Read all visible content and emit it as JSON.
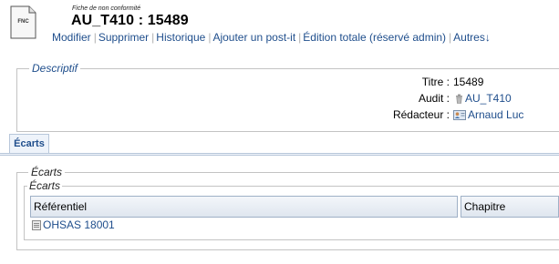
{
  "header": {
    "icon_label": "FNC",
    "subtitle": "Fiche de non conformité",
    "title": "AU_T410 : 15489"
  },
  "actions": [
    {
      "label": "Modifier"
    },
    {
      "label": "Supprimer"
    },
    {
      "label": "Historique"
    },
    {
      "label": "Ajouter un post-it"
    },
    {
      "label": "Édition totale (réservé admin)"
    },
    {
      "label": "Autres↓"
    }
  ],
  "descriptif": {
    "legend": "Descriptif",
    "fields": {
      "titre_label": "Titre :",
      "titre_value": "15489",
      "audit_label": "Audit :",
      "audit_value": "AU_T410",
      "audit_icon": "trash-icon",
      "redacteur_label": "Rédacteur :",
      "redacteur_value": "Arnaud Luc",
      "redacteur_icon": "user-card-icon"
    }
  },
  "tabs": [
    {
      "label": "Écarts",
      "active": true
    }
  ],
  "ecarts": {
    "outer_legend": "Écarts",
    "inner_legend": "Écarts",
    "columns": [
      "Référentiel",
      "Chapitre"
    ],
    "rows": [
      {
        "referentiel": "OHSAS 18001",
        "icon": "document-icon"
      }
    ]
  },
  "colors": {
    "link": "#1f4e8c",
    "border": "#c3c3c3",
    "tab_bg": "#eef3fa"
  }
}
